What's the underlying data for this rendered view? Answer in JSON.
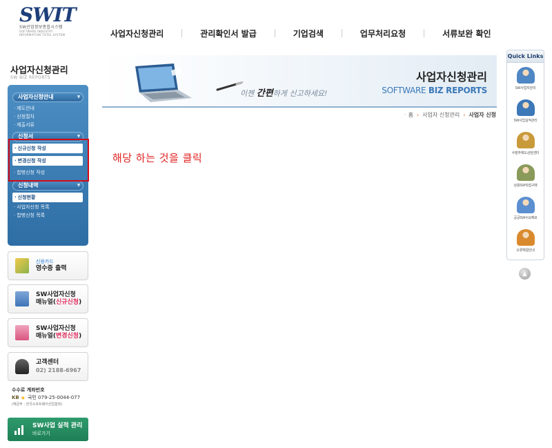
{
  "header": {
    "logo": {
      "mark": "SWIT",
      "line1": "SW산업정보종합시스템",
      "line2": "SOFTWARE INDUSTRY",
      "line3": "INFORMATION TOTAL SYSTEM"
    },
    "nav": [
      "사업자신청관리",
      "관리확인서 발급",
      "기업검색",
      "업무처리요청",
      "서류보완 확인"
    ]
  },
  "sidebar": {
    "title": "사업자신청관리",
    "subtitle": "SW BIZ REPORTS",
    "groups": [
      {
        "label": "사업자신청안내",
        "items": [
          "제도안내",
          "신청절차",
          "제출서류"
        ]
      },
      {
        "label": "신청서",
        "items": [
          "신규신청 작성",
          "변경신청 작성",
          "합병신청 작성"
        ]
      },
      {
        "label": "신청내역",
        "items": [
          "신청현황",
          "사업자신청 목록",
          "합병신청 목록"
        ]
      }
    ],
    "card_box": {
      "top": "신용카드",
      "main": "영수증 출력"
    },
    "manual_new": {
      "line1": "SW사업자신청",
      "line2_prefix": "매뉴얼(",
      "highlight": "신규신청",
      "line2_suffix": ")"
    },
    "manual_change": {
      "line1": "SW사업자신청",
      "line2_prefix": "매뉴얼(",
      "highlight": "변경신청",
      "line2_suffix": ")"
    },
    "customer_center": {
      "title": "고객센터",
      "phone": "02) 2188-6967"
    },
    "account": {
      "title": "수수료 계좌번호",
      "bank": "KB",
      "number": "국민 079-25-0044-077",
      "holder": "(예금주 : 한국소프트웨어산업협회)"
    },
    "shortcut": {
      "line1": "SW사업 실적 관리",
      "line2": "바로가기"
    }
  },
  "banner": {
    "page_title": "사업자신청관리",
    "en_prefix": "SOFTWARE ",
    "en_bold": "BIZ REPORTS",
    "slogan_prefix": "이젠 ",
    "slogan_bold": "간편",
    "slogan_suffix": "하게 신고하세요!"
  },
  "breadcrumb": [
    "홈",
    "사업자 신청관리",
    "사업자 신청"
  ],
  "instruction": "해당 하는 것을 클릭",
  "quick_links": {
    "title": "Quick Links",
    "items": [
      {
        "label": "SW사업자관리",
        "color": "#4f86c4"
      },
      {
        "label": "SW사업실적관리",
        "color": "#3d78b8"
      },
      {
        "label": "수발주제도상담센터",
        "color": "#c99a3a"
      },
      {
        "label": "상용SW직접구매",
        "color": "#8a9a5a"
      },
      {
        "label": "공공SW수요예보",
        "color": "#5b8fd0"
      },
      {
        "label": "오류해결안내",
        "color": "#d98a2e"
      }
    ]
  },
  "colors": {
    "accent": "#2e6ea5",
    "highlight_border": "#d70a14",
    "instruction": "#e02020",
    "manual_highlight": "#e0285a"
  }
}
